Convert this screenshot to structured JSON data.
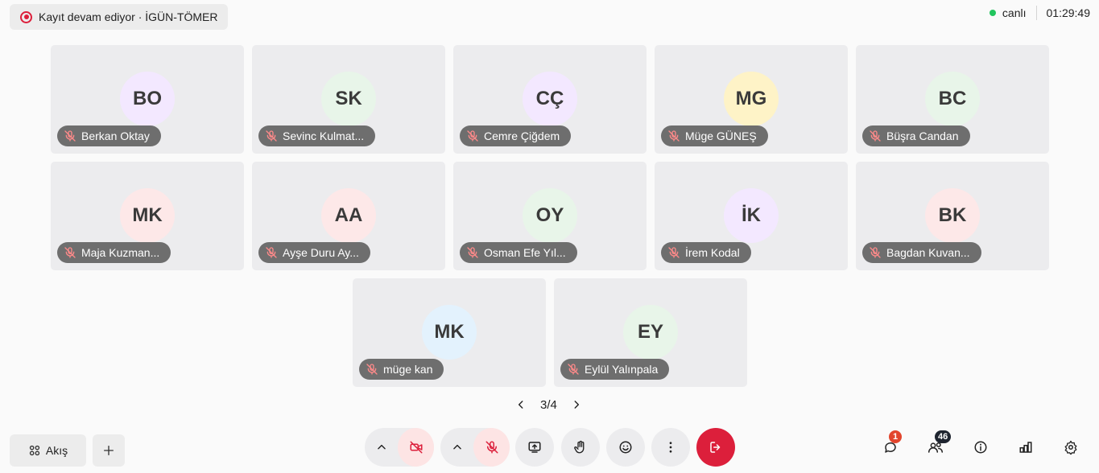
{
  "recording": {
    "label": "Kayıt devam ediyor · İGÜN-TÖMER"
  },
  "status": {
    "live_label": "canlı",
    "elapsed": "01:29:49"
  },
  "participants": [
    {
      "initials": "BO",
      "name": "Berkan Oktay",
      "avatar_bg": "#f3e8ff",
      "muted": true
    },
    {
      "initials": "SK",
      "name": "Sevinc Kulmat...",
      "avatar_bg": "#e8f5e9",
      "muted": true
    },
    {
      "initials": "CÇ",
      "name": "Cemre Çiğdem",
      "avatar_bg": "#f3e8ff",
      "muted": true
    },
    {
      "initials": "MG",
      "name": "Müge GÜNEŞ",
      "avatar_bg": "#fef3c7",
      "muted": true
    },
    {
      "initials": "BC",
      "name": "Büşra Candan",
      "avatar_bg": "#e8f5e9",
      "muted": true
    },
    {
      "initials": "MK",
      "name": "Maja Kuzman...",
      "avatar_bg": "#fde8e8",
      "muted": true
    },
    {
      "initials": "AA",
      "name": "Ayşe Duru Ay...",
      "avatar_bg": "#fde8e8",
      "muted": true
    },
    {
      "initials": "OY",
      "name": "Osman Efe Yıl...",
      "avatar_bg": "#e8f5e9",
      "muted": true
    },
    {
      "initials": "İK",
      "name": "İrem Kodal",
      "avatar_bg": "#f3e8ff",
      "muted": true
    },
    {
      "initials": "BK",
      "name": "Bagdan Kuvan...",
      "avatar_bg": "#fde8e8",
      "muted": true
    },
    {
      "initials": "MK",
      "name": "müge kan",
      "avatar_bg": "#e3f2fd",
      "muted": true
    },
    {
      "initials": "EY",
      "name": "Eylül Yalınpala",
      "avatar_bg": "#e8f5e9",
      "muted": true
    }
  ],
  "pagination": {
    "label": "3/4"
  },
  "toolbar": {
    "akis_label": "Akış",
    "chat_badge": "1",
    "participants_badge": "46"
  },
  "colors": {
    "danger": "#dc1f3b",
    "live": "#22c55e",
    "tile_bg": "#ececee"
  },
  "icons": [
    "record-icon",
    "layout-grid-icon",
    "plus-icon",
    "chevron-up-icon",
    "camera-off-icon",
    "mic-off-icon",
    "screen-share-icon",
    "raise-hand-icon",
    "emoji-icon",
    "more-vertical-icon",
    "leave-icon",
    "chat-icon",
    "participants-icon",
    "info-icon",
    "stats-icon",
    "settings-icon"
  ]
}
